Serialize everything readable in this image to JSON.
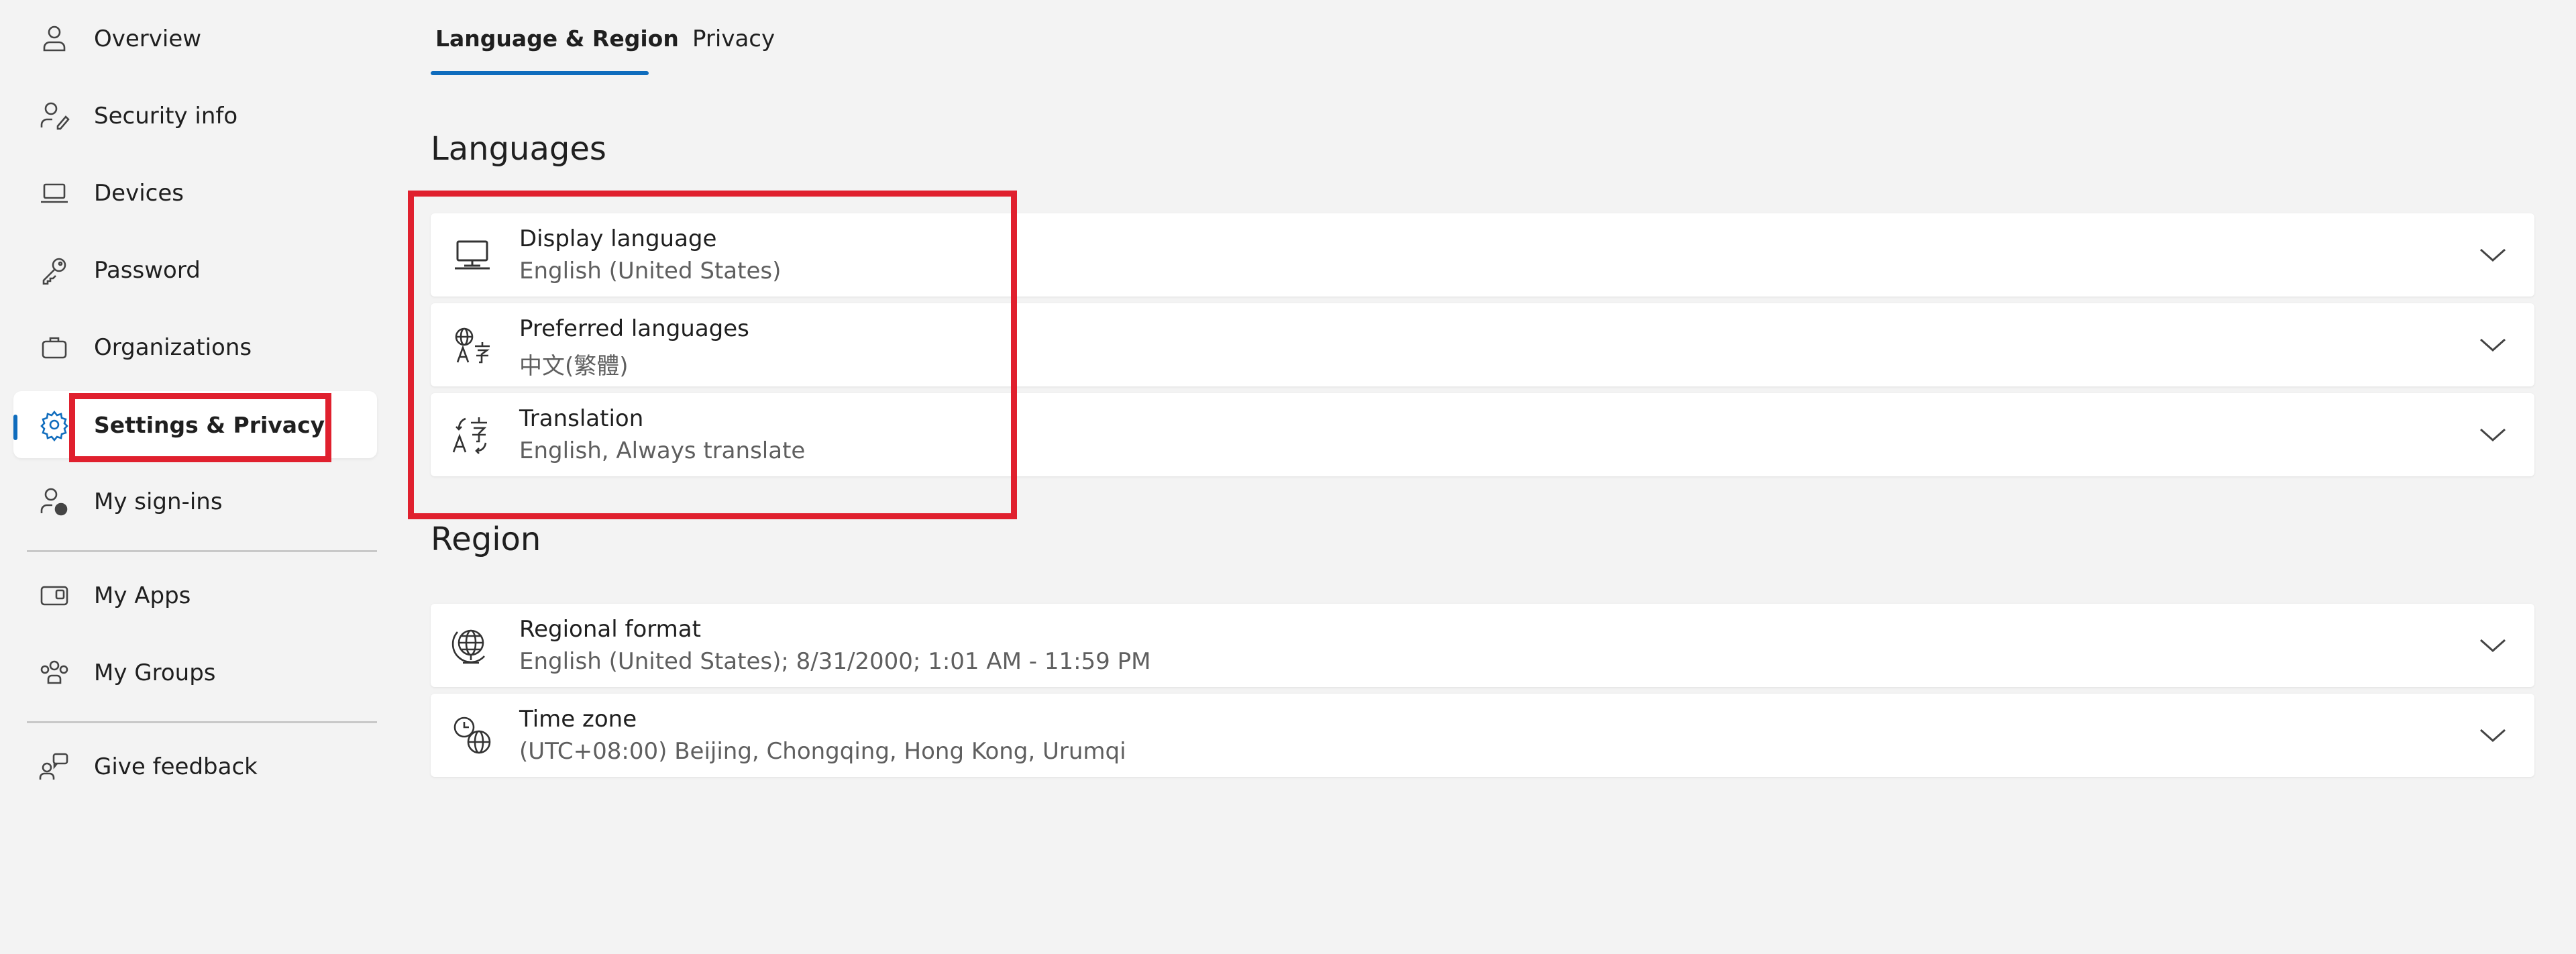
{
  "sidebar": {
    "items": [
      {
        "label": "Overview",
        "icon": "person-icon"
      },
      {
        "label": "Security info",
        "icon": "person-key-icon"
      },
      {
        "label": "Devices",
        "icon": "laptop-icon"
      },
      {
        "label": "Password",
        "icon": "key-icon"
      },
      {
        "label": "Organizations",
        "icon": "briefcase-icon"
      },
      {
        "label": "Settings & Privacy",
        "icon": "gear-icon"
      },
      {
        "label": "My sign-ins",
        "icon": "person-signin-icon"
      },
      {
        "label": "My Apps",
        "icon": "apps-icon"
      },
      {
        "label": "My Groups",
        "icon": "people-group-icon"
      },
      {
        "label": "Give feedback",
        "icon": "feedback-icon"
      }
    ],
    "active_index": 5
  },
  "tabs": [
    {
      "label": "Language & Region"
    },
    {
      "label": "Privacy"
    }
  ],
  "languages": {
    "title": "Languages",
    "rows": [
      {
        "title": "Display language",
        "value": "English (United States)",
        "icon": "monitor-icon"
      },
      {
        "title": "Preferred languages",
        "value": "中文(繁體)",
        "icon": "globe-language-icon"
      },
      {
        "title": "Translation",
        "value": "English, Always translate",
        "icon": "translate-icon"
      }
    ]
  },
  "region": {
    "title": "Region",
    "rows": [
      {
        "title": "Regional format",
        "value": "English (United States); 8/31/2000; 1:01 AM - 11:59 PM",
        "icon": "globe-settings-icon"
      },
      {
        "title": "Time zone",
        "value": "(UTC+08:00) Beijing, Chongqing, Hong Kong, Urumqi",
        "icon": "clock-globe-icon"
      }
    ]
  },
  "colors": {
    "accent": "#0f6cbd",
    "highlight": "#e0202e",
    "background": "#f3f3f3"
  }
}
